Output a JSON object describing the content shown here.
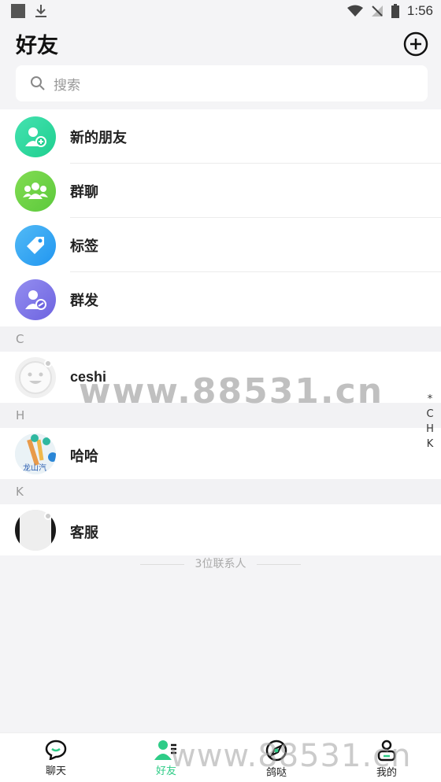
{
  "status_bar": {
    "time": "1:56"
  },
  "header": {
    "title": "好友"
  },
  "search": {
    "placeholder": "搜索"
  },
  "menu": [
    {
      "label": "新的朋友",
      "icon": "add-friend-icon",
      "color": "#2ed8a0"
    },
    {
      "label": "群聊",
      "icon": "group-chat-icon",
      "color": "#6ad24a"
    },
    {
      "label": "标签",
      "icon": "tag-icon",
      "color": "#2ea6f2"
    },
    {
      "label": "群发",
      "icon": "broadcast-icon",
      "color": "#7b74e8"
    }
  ],
  "contacts": [
    {
      "section": "C",
      "name": "ceshi"
    },
    {
      "section": "H",
      "name": "哈哈",
      "avatar_text": "龙山汽"
    },
    {
      "section": "K",
      "name": "客服"
    }
  ],
  "footer": {
    "count_text": "3位联系人"
  },
  "alpha_index": [
    "*",
    "C",
    "H",
    "K"
  ],
  "watermark": "www.88531.cn",
  "tabbar": {
    "tabs": [
      {
        "label": "聊天",
        "icon": "chat-icon"
      },
      {
        "label": "好友",
        "icon": "friends-icon",
        "active": true
      },
      {
        "label": "鸽哒",
        "icon": "discover-icon"
      },
      {
        "label": "我的",
        "icon": "profile-icon"
      }
    ]
  },
  "colors": {
    "accent": "#2ecc87"
  }
}
